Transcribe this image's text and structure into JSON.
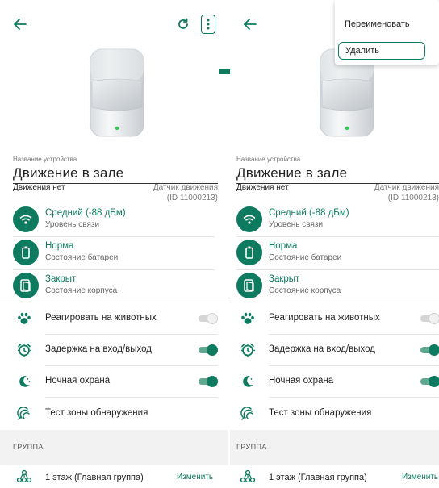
{
  "colors": {
    "accent": "#0e7a5f",
    "toggle_on_track": "#5fa98f",
    "toggle_off_track": "#d4d4d4",
    "group_band": "#f2f2f2"
  },
  "screens": [
    {
      "device": {
        "name_caption": "Название устройства",
        "name_value": "Движение в зале",
        "motion_status": "Движения нет",
        "type_line1": "Датчик движения",
        "type_line2": "(ID 11000213)"
      },
      "status": [
        {
          "title": "Средний (-88 дБм)",
          "subtitle": "Уровень связи",
          "icon": "wifi-icon"
        },
        {
          "title": "Норма",
          "subtitle": "Состояние батареи",
          "icon": "battery-icon"
        },
        {
          "title": "Закрыт",
          "subtitle": "Состояние корпуса",
          "icon": "case-icon"
        }
      ],
      "settings": [
        {
          "label": "Реагировать на животных",
          "icon": "paw-icon",
          "toggle": "off"
        },
        {
          "label": "Задержка на вход/выход",
          "icon": "delay-icon",
          "toggle": "on"
        },
        {
          "label": "Ночная охрана",
          "icon": "moon-icon",
          "toggle": "on"
        },
        {
          "label": "Тест зоны обнаружения",
          "icon": "zone-test-icon",
          "toggle": null
        }
      ],
      "group": {
        "section_label": "ГРУППА",
        "name": "1 этаж (Главная группа)",
        "change_label": "Изменить"
      }
    },
    {
      "device": {
        "name_caption": "Название устройства",
        "name_value": "Движение в зале",
        "motion_status": "Движения нет",
        "type_line1": "Датчик движения",
        "type_line2": "(ID 11000213)"
      },
      "status": [
        {
          "title": "Средний (-88 дБм)",
          "subtitle": "Уровень связи",
          "icon": "wifi-icon"
        },
        {
          "title": "Норма",
          "subtitle": "Состояние батареи",
          "icon": "battery-icon"
        },
        {
          "title": "Закрыт",
          "subtitle": "Состояние корпуса",
          "icon": "case-icon"
        }
      ],
      "settings": [
        {
          "label": "Реагировать на животных",
          "icon": "paw-icon",
          "toggle": "off"
        },
        {
          "label": "Задержка на вход/выход",
          "icon": "delay-icon",
          "toggle": "on"
        },
        {
          "label": "Ночная охрана",
          "icon": "moon-icon",
          "toggle": "on"
        },
        {
          "label": "Тест зоны обнаружения",
          "icon": "zone-test-icon",
          "toggle": null
        }
      ],
      "group": {
        "section_label": "ГРУППА",
        "name": "1 этаж (Главная группа)",
        "change_label": "Изменить"
      }
    }
  ],
  "popup_menu": {
    "items": [
      "Переименовать",
      "Удалить"
    ],
    "highlighted": "Удалить"
  }
}
